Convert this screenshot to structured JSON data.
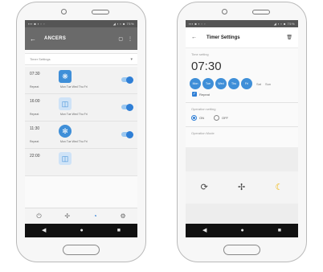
{
  "left_phone": {
    "status_bar": {
      "left": "▪▪▪ ■ ▪ ▫ ▫",
      "right": "◢ ▪ ▪ ■ 75%"
    },
    "header": {
      "back": "←",
      "title": "ANCERS",
      "action1": "▢",
      "action2": "⋮"
    },
    "filter": {
      "label": "Timer Settings",
      "chevron": "▾"
    },
    "timers": [
      {
        "time": "07:30",
        "label": "Repeat",
        "days": "Mon Tue Wed Thu Fri",
        "icon": "fan-mode-icon",
        "enabled": true
      },
      {
        "time": "16:00",
        "label": "Repeat",
        "days": "Mon Tue Wed Thu Fri",
        "icon": "auto-mode-icon",
        "enabled": true
      },
      {
        "time": "11:30",
        "label": "Repeat",
        "days": "Mon Tue Wed Thu Fri",
        "icon": "snowflake-icon",
        "enabled": true
      },
      {
        "time": "22:00",
        "label": "Repeat",
        "days": "",
        "icon": "auto-mode-icon",
        "enabled": true
      }
    ],
    "bottom_tabs": [
      "power-icon",
      "fan-icon",
      "timer-icon",
      "settings-icon"
    ],
    "nav": {
      "back": "◀",
      "home": "●",
      "recent": "■"
    }
  },
  "right_phone": {
    "status_bar": {
      "left": "▪▪▪ ■ ▪ ▫ ▫",
      "right": "◢ ▪ ▪ ■ 75%"
    },
    "header": {
      "back": "←",
      "title": "Timer Settings",
      "delete": "🗑"
    },
    "time_label": "Time setting",
    "time_value": "07:30",
    "days_selected": [
      "Mon",
      "Tue",
      "Wed",
      "Thu",
      "Fri"
    ],
    "days_unselected": [
      "Sat",
      "Sun"
    ],
    "repeat_label": "Repeat",
    "operation_label": "Operation setting",
    "option_on": "ON",
    "option_off": "OFF",
    "mode_label": "Operation Mode",
    "modes": [
      "auto-mode-icon",
      "fan-icon",
      "sleep-mode-icon"
    ],
    "nav": {
      "back": "◀",
      "home": "●",
      "recent": "■"
    }
  },
  "colors": {
    "accent": "#2f7fd6",
    "header_gray": "#6a6a6a"
  }
}
